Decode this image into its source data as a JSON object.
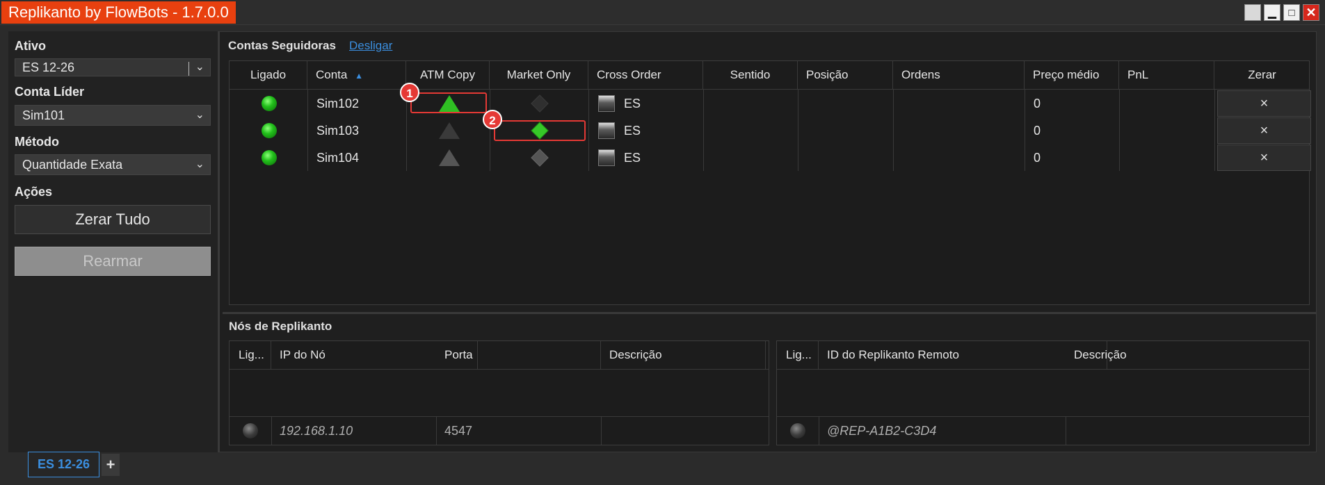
{
  "window": {
    "title": "Replikanto by FlowBots - 1.7.0.0",
    "controls": [
      "maximize-alt-icon",
      "minimize-icon",
      "maximize-icon",
      "close-icon"
    ]
  },
  "left_panel": {
    "ativo_label": "Ativo",
    "ativo_value": "ES 12-26",
    "conta_lider_label": "Conta Líder",
    "conta_lider_value": "Sim101",
    "metodo_label": "Método",
    "metodo_value": "Quantidade Exata",
    "acoes_label": "Ações",
    "zerar_tudo_label": "Zerar Tudo",
    "rearmar_label": "Rearmar"
  },
  "followers": {
    "title": "Contas Seguidoras",
    "disconnect_link": "Desligar",
    "columns": [
      "Ligado",
      "Conta",
      "ATM Copy",
      "Market Only",
      "Cross Order",
      "Sentido",
      "Posição",
      "Ordens",
      "Preço médio",
      "PnL",
      "Zerar"
    ],
    "rows": [
      {
        "ligado": true,
        "conta": "Sim102",
        "atm_copy": "on",
        "market_only": "dim",
        "cross_order": "ES",
        "sentido": "",
        "posicao": "",
        "ordens": "",
        "preco_medio": "0",
        "pnl": "",
        "zerar": "×"
      },
      {
        "ligado": true,
        "conta": "Sim103",
        "atm_copy": "dim",
        "market_only": "on",
        "cross_order": "ES",
        "sentido": "",
        "posicao": "",
        "ordens": "",
        "preco_medio": "0",
        "pnl": "",
        "zerar": "×"
      },
      {
        "ligado": true,
        "conta": "Sim104",
        "atm_copy": "off",
        "market_only": "off",
        "cross_order": "ES",
        "sentido": "",
        "posicao": "",
        "ordens": "",
        "preco_medio": "0",
        "pnl": "",
        "zerar": "×"
      }
    ],
    "callouts": [
      "1",
      "2"
    ],
    "sort_indicator": "▲"
  },
  "nodes": {
    "title": "Nós de Replikanto",
    "left_table": {
      "columns": [
        "Lig...",
        "IP do Nó",
        "Porta",
        "Descrição"
      ],
      "row": {
        "ligado": false,
        "ip": "192.168.1.10",
        "porta": "4547",
        "descricao": ""
      }
    },
    "right_table": {
      "columns": [
        "Lig...",
        "ID do Replikanto Remoto",
        "Descrição"
      ],
      "row": {
        "ligado": false,
        "id": "@REP-A1B2-C3D4",
        "descricao": ""
      }
    }
  },
  "tabs": {
    "active": "ES 12-26",
    "add": "+"
  },
  "colors": {
    "title_bg": "#e8400f",
    "link": "#3b8fe0",
    "callout": "#e53935",
    "on_green": "#2fbf23"
  }
}
